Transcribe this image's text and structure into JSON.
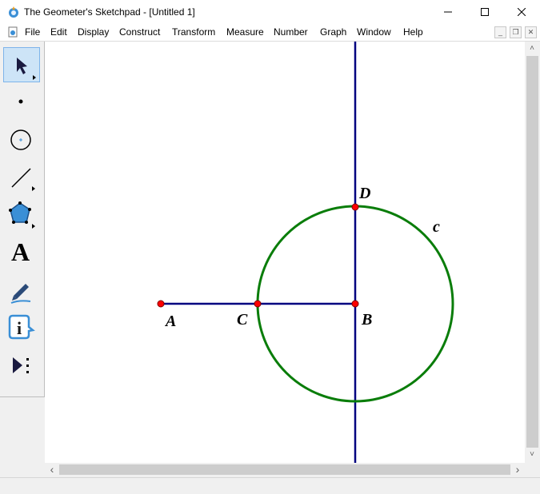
{
  "window": {
    "title": "The Geometer's Sketchpad - [Untitled 1]",
    "controls": {
      "minimize": "—",
      "maximize": "☐",
      "close": "✕"
    }
  },
  "menu": {
    "items": [
      "File",
      "Edit",
      "Display",
      "Construct",
      "Transform",
      "Measure",
      "Number",
      "Graph",
      "Window",
      "Help"
    ],
    "mdi": {
      "minimize": "_",
      "restore": "❐",
      "close": "✕"
    }
  },
  "toolbox": {
    "tools": [
      {
        "name": "arrow-tool",
        "icon": "arrow-select-icon"
      },
      {
        "name": "point-tool",
        "icon": "point-icon"
      },
      {
        "name": "compass-tool",
        "icon": "compass-circle-icon"
      },
      {
        "name": "straightedge-tool",
        "icon": "segment-icon"
      },
      {
        "name": "polygon-tool",
        "icon": "pentagon-icon"
      },
      {
        "name": "text-tool",
        "icon": "text-A-icon",
        "glyph": "A"
      },
      {
        "name": "marker-tool",
        "icon": "marker-pen-icon"
      },
      {
        "name": "information-tool",
        "icon": "info-icon",
        "glyph": "i"
      },
      {
        "name": "custom-tool",
        "icon": "custom-tool-icon"
      }
    ]
  },
  "sketch": {
    "points": [
      {
        "label": "A"
      },
      {
        "label": "C"
      },
      {
        "label": "B"
      },
      {
        "label": "D"
      }
    ],
    "circle_label": "c",
    "colors": {
      "segment": "#000080",
      "vertical_line": "#000080",
      "circle": "#0a7d0a",
      "point_fill": "#ff0000",
      "point_stroke": "#800000"
    }
  },
  "scrollbars": {
    "up": "˄",
    "down": "˅",
    "left": "‹",
    "right": "›"
  }
}
